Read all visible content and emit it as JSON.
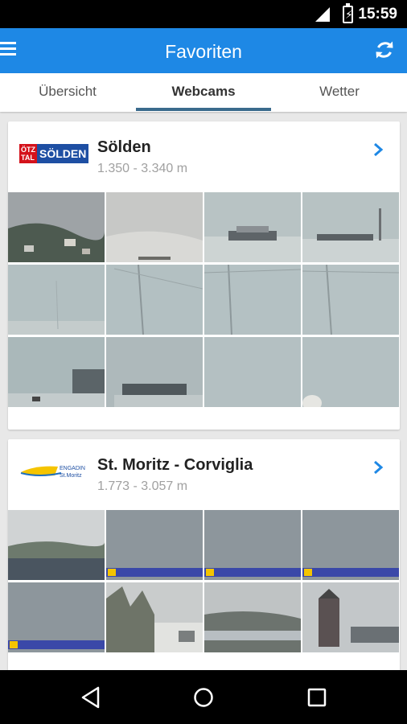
{
  "status": {
    "time": "15:59"
  },
  "app_bar": {
    "title": "Favoriten"
  },
  "tabs": [
    {
      "label": "Übersicht",
      "active": false
    },
    {
      "label": "Webcams",
      "active": true
    },
    {
      "label": "Wetter",
      "active": false
    }
  ],
  "resorts": [
    {
      "name": "Sölden",
      "altitude": "1.350 - 3.340 m",
      "logo": {
        "line1": "ÖTZ",
        "line2": "TAL",
        "brand": "SÖLDEN",
        "colors": {
          "red": "#d4121b",
          "blue": "#1e4fa3"
        }
      },
      "webcams": [
        {
          "scene": "foggy-valley-village"
        },
        {
          "scene": "snowy-slope-fog"
        },
        {
          "scene": "station-building-snow"
        },
        {
          "scene": "lift-station-snow"
        },
        {
          "scene": "snow-field-fog"
        },
        {
          "scene": "lift-pylons-fog"
        },
        {
          "scene": "lift-pylon-snow"
        },
        {
          "scene": "lift-pylon-foggy"
        },
        {
          "scene": "chairlift-station"
        },
        {
          "scene": "mountain-hut-fog"
        },
        {
          "scene": "white-out"
        },
        {
          "scene": "white-out-dome"
        }
      ]
    },
    {
      "name": "St. Moritz - Corviglia",
      "altitude": "1.773 - 3.057 m",
      "logo": {
        "line1": "ENGADIN",
        "line2": "St.Moritz"
      },
      "webcams": [
        {
          "scene": "lake-village-clouds"
        },
        {
          "scene": "grey-sky-banner"
        },
        {
          "scene": "grey-sky-banner"
        },
        {
          "scene": "grey-sky-banner"
        },
        {
          "scene": "grey-sky-banner"
        },
        {
          "scene": "snowy-forest"
        },
        {
          "scene": "valley-lake-fog"
        },
        {
          "scene": "hotel-tower-lake"
        }
      ]
    }
  ],
  "colors": {
    "primary": "#1e88e5",
    "tab_indicator": "#3a6a8c",
    "chevron": "#1e88e5"
  }
}
